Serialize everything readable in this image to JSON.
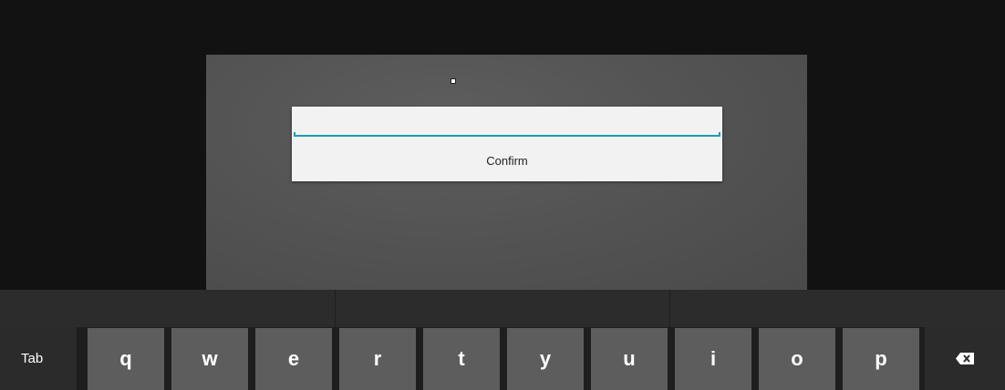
{
  "dialog": {
    "input_value": "",
    "confirm_label": "Confirm"
  },
  "keyboard": {
    "tab_label": "Tab",
    "letters": [
      "q",
      "w",
      "e",
      "r",
      "t",
      "y",
      "u",
      "i",
      "o",
      "p"
    ],
    "backspace_icon": "backspace-icon"
  },
  "colors": {
    "accent": "#1e9bb4",
    "key_background": "#5d5d5d",
    "function_key_background": "#2b2b2b",
    "dialog_background": "#f2f2f2"
  }
}
